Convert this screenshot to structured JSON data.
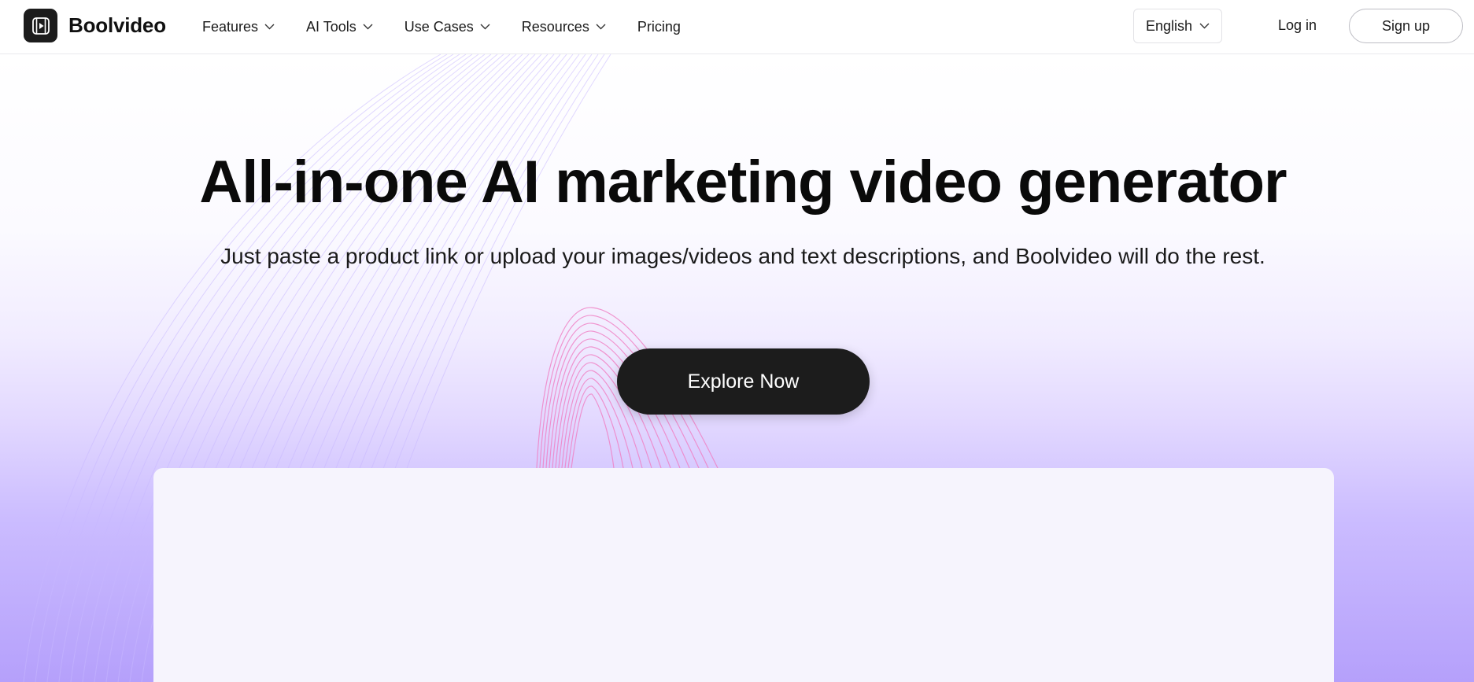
{
  "brand": {
    "name": "Boolvideo"
  },
  "nav": {
    "items": [
      {
        "label": "Features",
        "has_dropdown": true
      },
      {
        "label": "AI Tools",
        "has_dropdown": true
      },
      {
        "label": "Use Cases",
        "has_dropdown": true
      },
      {
        "label": "Resources",
        "has_dropdown": true
      },
      {
        "label": "Pricing",
        "has_dropdown": false
      }
    ]
  },
  "header": {
    "language": "English",
    "login_label": "Log in",
    "signup_label": "Sign up"
  },
  "hero": {
    "title": "All-in-one AI marketing video generator",
    "subtitle": "Just paste a product link or upload your images/videos and text descriptions, and Boolvideo will do the rest.",
    "cta_label": "Explore Now"
  },
  "colors": {
    "cta_background": "#1c1c1c",
    "gradient_bottom": "#b5a0fb",
    "accent_pink": "#f07fc4",
    "accent_lavender": "#c6b4ff"
  }
}
